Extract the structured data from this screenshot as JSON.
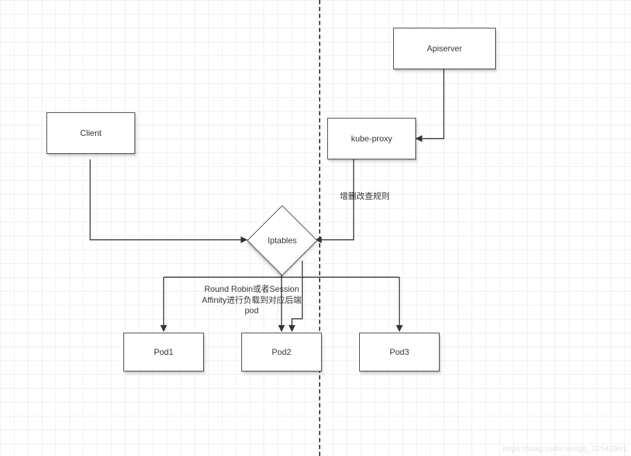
{
  "nodes": {
    "client": {
      "label": "Client"
    },
    "apiserver": {
      "label": "Apiserver"
    },
    "kubeproxy": {
      "label": "kube-proxy"
    },
    "iptables": {
      "label": "Iptables"
    },
    "pod1": {
      "label": "Pod1"
    },
    "pod2": {
      "label": "Pod2"
    },
    "pod3": {
      "label": "Pod3"
    }
  },
  "annotations": {
    "crud_rules": "增删改查规则",
    "lb_text": "Round Robin或者Session\nAffinity进行负载到对应后端\npod"
  },
  "watermark": "https://blog.csdn.net/qq_22543991"
}
